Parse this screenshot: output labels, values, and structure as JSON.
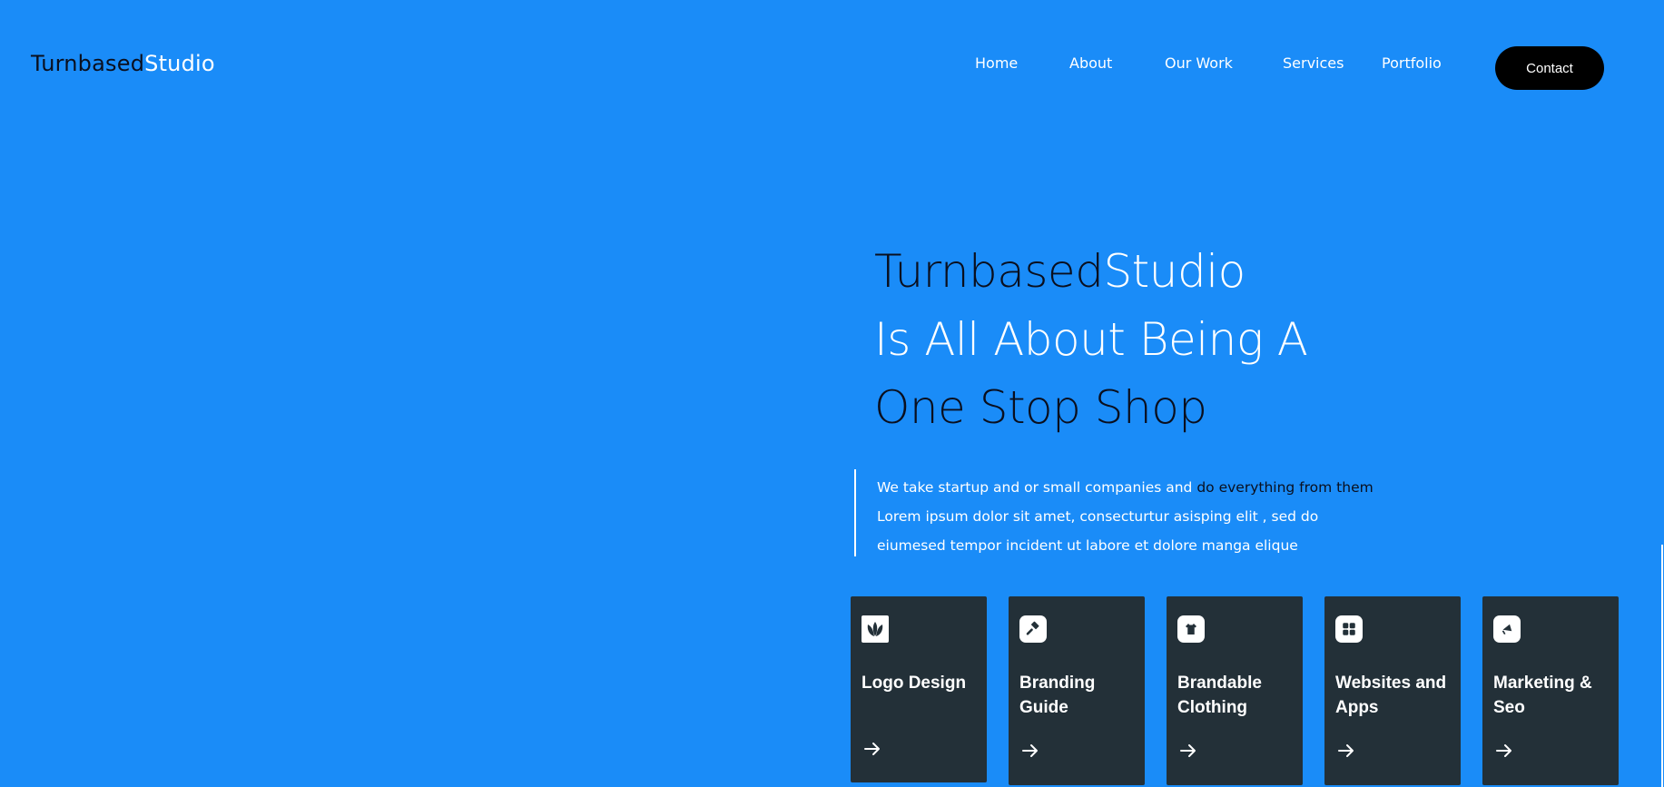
{
  "brand": {
    "part1": "Turnbased",
    "part2": "Studio"
  },
  "nav": {
    "items": [
      {
        "label": "Home"
      },
      {
        "label": "About"
      },
      {
        "label": "Our Work"
      },
      {
        "label": "Services"
      },
      {
        "label": "Portfolio"
      }
    ],
    "contact_label": "Contact"
  },
  "hero": {
    "title_part1": "Turnbased",
    "title_part2": "Studio",
    "line2": "Is All About Being A",
    "line3": "One Stop Shop"
  },
  "description": {
    "line1_a": "We take startup and or small companies and ",
    "line1_b": "do everything from them",
    "line2": "Lorem ipsum dolor sit amet, consecturtur asisping elit , sed do",
    "line3": "eiumesed tempor incident ut labore et dolore manga elique"
  },
  "services": [
    {
      "icon": "lotus-icon",
      "line1": "Logo Design",
      "line2": ""
    },
    {
      "icon": "hammer-icon",
      "line1": "Branding",
      "line2": "Guide"
    },
    {
      "icon": "shirt-icon",
      "line1": "Brandable",
      "line2": "Clothing"
    },
    {
      "icon": "grid-icon",
      "line1": "Websites and",
      "line2": "Apps"
    },
    {
      "icon": "megaphone-icon",
      "line1": "Marketing &",
      "line2": "Seo"
    }
  ],
  "colors": {
    "background": "#1a8cf8",
    "card": "#233038",
    "dark_text": "#0a0f1e",
    "contact_button": "#000000"
  }
}
